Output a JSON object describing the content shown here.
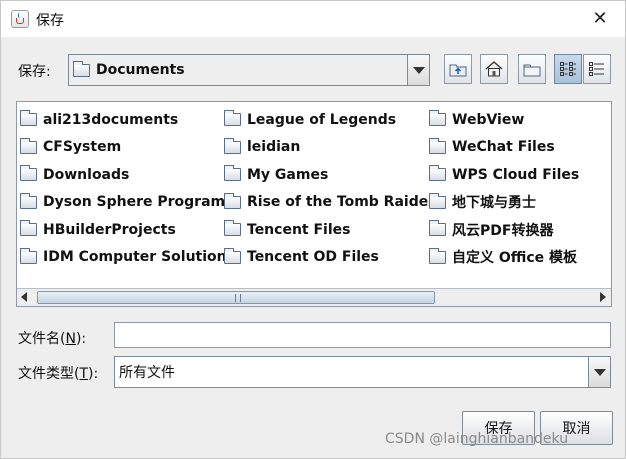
{
  "window": {
    "title": "保存",
    "close_icon": "close-icon"
  },
  "save_in": {
    "label": "保存:",
    "value": "Documents"
  },
  "toolbar": {
    "icons": [
      "up-folder-icon",
      "home-icon",
      "new-folder-icon",
      "list-view-icon",
      "details-view-icon"
    ],
    "selected": "list-view-icon"
  },
  "files": {
    "columns": [
      [
        "ali213documents",
        "CFSystem",
        "Downloads",
        "Dyson Sphere Program",
        "HBuilderProjects",
        "IDM Computer Solutions"
      ],
      [
        "League of Legends",
        "leidian",
        "My Games",
        "Rise of the Tomb Raider",
        "Tencent Files",
        "Tencent OD Files"
      ],
      [
        "WebView",
        "WeChat Files",
        "WPS Cloud Files",
        "地下城与勇士",
        "风云PDF转换器",
        "自定义 Office 模板"
      ]
    ]
  },
  "filename": {
    "label_prefix": "文件名(",
    "mnemonic": "N",
    "label_suffix": "):",
    "value": ""
  },
  "filetype": {
    "label_prefix": "文件类型(",
    "mnemonic": "T",
    "label_suffix": "):",
    "value": "所有文件"
  },
  "buttons": {
    "save": "保存",
    "cancel": "取消"
  },
  "watermark": "CSDN @lainghianbandeku",
  "colors": {
    "selected_toggle": "#b7cbe0",
    "border": "#7a8a99"
  }
}
